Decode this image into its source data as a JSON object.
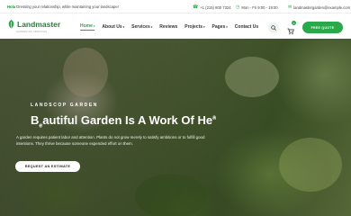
{
  "topbar": {
    "message_prefix": "Hola",
    "message": " Dressing your relationship, while maintaining your landscape!",
    "phone": "+1 (215) 800 7324",
    "hours": "Mon - Fri 9:00 - 19:00",
    "email": "landmastergarden@example.com"
  },
  "header": {
    "logo_text": "Landmaster",
    "logo_sub": "GARDENING SERVICES",
    "nav": [
      {
        "label": "Home"
      },
      {
        "label": "About Us"
      },
      {
        "label": "Services"
      },
      {
        "label": "Reviews"
      },
      {
        "label": "Projects"
      },
      {
        "label": "Pages"
      },
      {
        "label": "Contact Us"
      }
    ],
    "cart_count": "0",
    "quote_label": "FREE QUOTE"
  },
  "hero": {
    "subtitle": "LANDSCOP GARDEN",
    "title_pre": "B",
    "title_lower": "e",
    "title_main": "autiful Garden Is A Work Of He",
    "title_sup": "a",
    "description": "A garden requires patient labor and attention. Plants do not grow merely to satisfy ambitions or to fulfill good intentions. They thrive because someone expended effort on them.",
    "cta_label": "REQUEST AN ESTIMATE"
  },
  "colors": {
    "accent": "#2aa84a",
    "brand_dark": "#2a7b3a"
  }
}
